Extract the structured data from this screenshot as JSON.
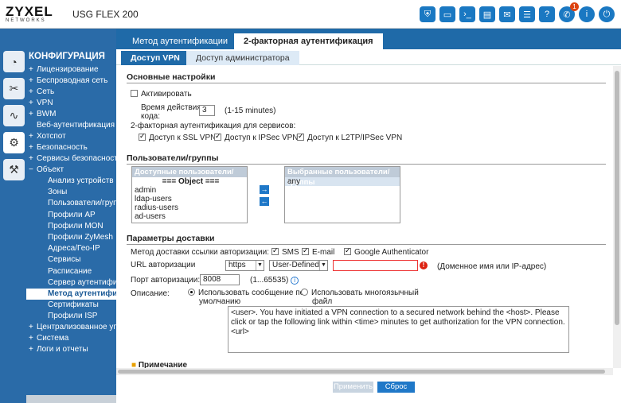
{
  "topbar": {
    "brand": "ZYXEL",
    "brand_sub": "NETWORKS",
    "model": "USG FLEX 200",
    "icons": [
      "shield-icon",
      "monitor-icon",
      "terminal-icon",
      "file-icon",
      "envelope-icon",
      "document-icon",
      "help-icon",
      "chat-icon",
      "info-icon",
      "logout-icon"
    ],
    "notification_count": "1"
  },
  "rail": {
    "icons": [
      "dashboard-icon",
      "tools-icon",
      "monitor-chart-icon",
      "gear-icon",
      "wrench-icon"
    ]
  },
  "sidebar": {
    "title": "КОНФИГУРАЦИЯ",
    "items": [
      {
        "pm": "+",
        "label": "Лицензирование"
      },
      {
        "pm": "+",
        "label": "Беспроводная сеть"
      },
      {
        "pm": "+",
        "label": "Сеть"
      },
      {
        "pm": "+",
        "label": "VPN"
      },
      {
        "pm": "+",
        "label": "BWM"
      },
      {
        "pm": "",
        "label": "Веб-аутентификация"
      },
      {
        "pm": "+",
        "label": "Хотспот"
      },
      {
        "pm": "+",
        "label": "Безопасность"
      },
      {
        "pm": "+",
        "label": "Сервисы безопасности"
      },
      {
        "pm": "−",
        "label": "Объект"
      }
    ],
    "subitems": [
      "Анализ устройств",
      "Зоны",
      "Пользователи/группы",
      "Профили AP",
      "Профили MON",
      "Профили ZyMesh",
      "Адреса/Гео-IP",
      "Сервисы",
      "Расписание",
      "Сервер аутентификации",
      "Метод аутентификации",
      "Сертификаты",
      "Профили ISP"
    ],
    "tail_items": [
      {
        "pm": "+",
        "label": "Централизованное управление"
      },
      {
        "pm": "+",
        "label": "Система"
      },
      {
        "pm": "+",
        "label": "Логи и отчеты"
      }
    ]
  },
  "tabs_main": [
    {
      "label": "Метод аутентификации",
      "active": false
    },
    {
      "label": "2-факторная аутентификация",
      "active": true
    }
  ],
  "tabs_sub": [
    {
      "label": "Доступ VPN",
      "active": true
    },
    {
      "label": "Доступ администратора",
      "active": false
    }
  ],
  "basic": {
    "title": "Основные настройки",
    "activate_label": "Активировать",
    "valid_time_label_1": "Время действия",
    "valid_time_label_2": "кода:",
    "valid_time_value": "3",
    "valid_time_hint": "(1-15 minutes)",
    "services_label": "2-факторная аутентификация для сервисов:",
    "services": [
      "Доступ к SSL VPN",
      "Доступ к IPSec VPN",
      "Доступ к L2TP/IPSec VPN"
    ]
  },
  "users": {
    "title": "Пользователи/группы",
    "available_header": "Доступные пользователи/группы",
    "available_group": "=== Object ===",
    "available": [
      "admin",
      "ldap-users",
      "radius-users",
      "ad-users"
    ],
    "selected_header": "Выбранные пользователи/группы",
    "selected": [
      "any"
    ],
    "move_right": "→",
    "move_left": "←"
  },
  "delivery": {
    "title": "Параметры доставки",
    "method_label": "Метод доставки ссылки авторизации:",
    "methods": [
      "SMS",
      "E-mail",
      "Google Authenticator"
    ],
    "url_label": "URL авторизации",
    "protocol": "https",
    "host_type": "User-Defined",
    "host_value": "",
    "host_hint": "(Доменное имя или IP-адрес)",
    "port_label": "Порт авторизации:",
    "port_value": "8008",
    "port_hint": "(1...65535)",
    "desc_label": "Описание:",
    "desc_opt1_line1": "Использовать сообщение по",
    "desc_opt1_line2": "умолчанию",
    "desc_opt2_line1": "Использовать многоязычный",
    "desc_opt2_line2": "файл",
    "message": "<user>. You have initiated a VPN connection to a secured network behind the <host>. Please click or tap the following link within <time> minutes to get authorization for the VPN connection. <url>"
  },
  "note": {
    "label": "Примечание"
  },
  "footer": {
    "apply": "Применить",
    "reset": "Сброс"
  },
  "colors": {
    "primary": "#1f6aa8",
    "sidebar": "#2a6ba8",
    "error": "#e33333"
  }
}
